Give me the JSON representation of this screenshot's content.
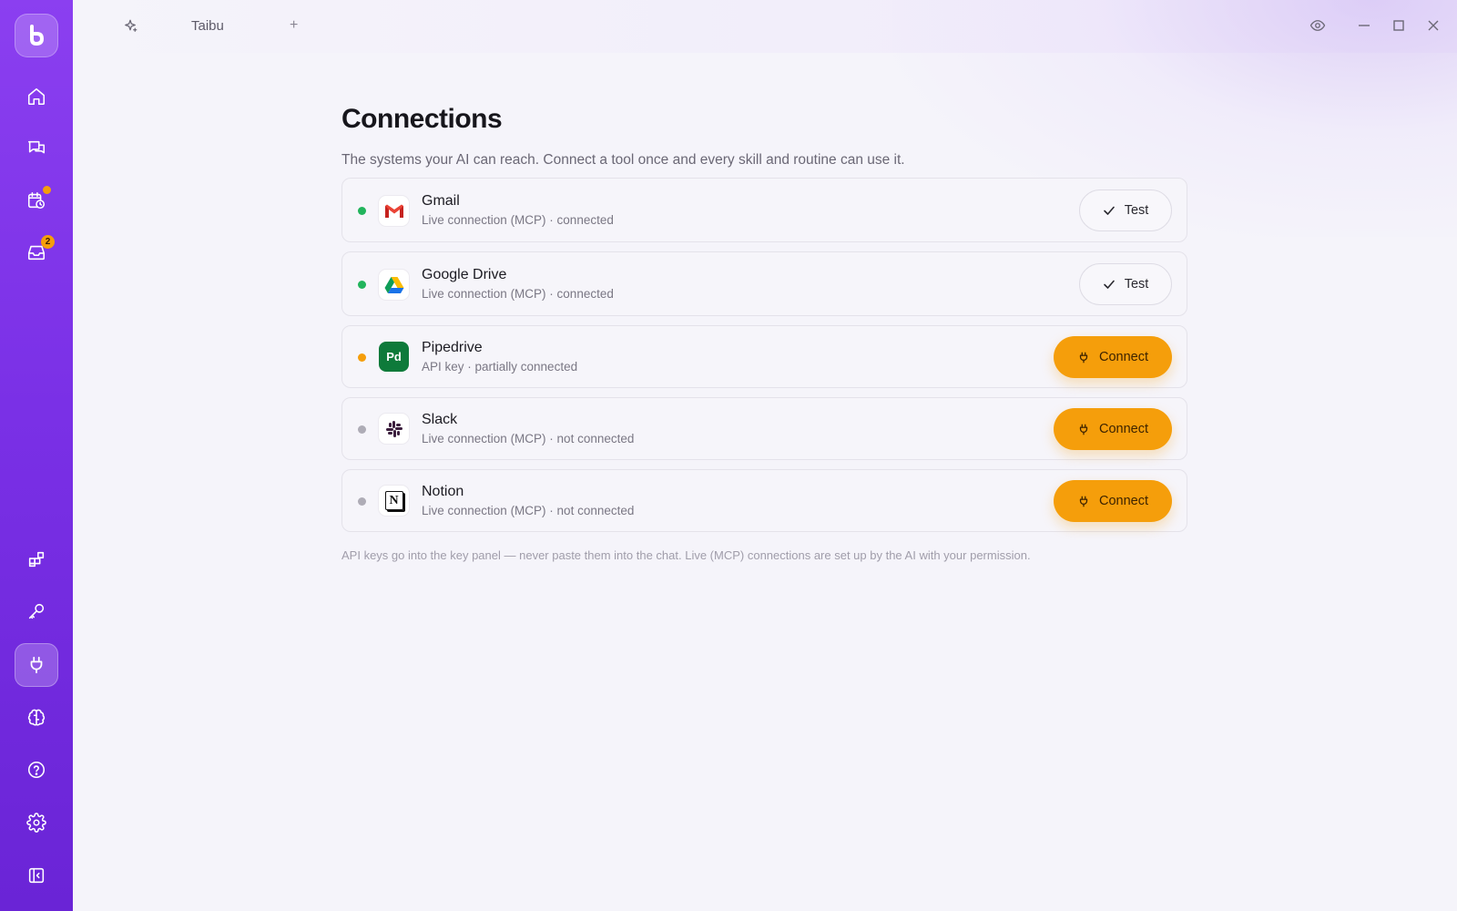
{
  "app": {
    "tab_title": "Taibu",
    "tab_add": "+",
    "accent": "#7a30e6",
    "highlight": "#f59e0b"
  },
  "sidebar": {
    "items": [
      {
        "name": "home",
        "icon": "home-icon"
      },
      {
        "name": "chats",
        "icon": "chat-bubbles-icon"
      },
      {
        "name": "routines",
        "icon": "calendar-clock-icon",
        "badge_dot": true
      },
      {
        "name": "inbox",
        "icon": "inbox-icon",
        "badge_count": "2"
      },
      {
        "name": "skills",
        "icon": "grid-plus-icon"
      },
      {
        "name": "keys",
        "icon": "key-icon"
      },
      {
        "name": "connections",
        "icon": "plug-icon",
        "active": true
      },
      {
        "name": "memory",
        "icon": "brain-icon"
      },
      {
        "name": "help",
        "icon": "help-circle-icon"
      },
      {
        "name": "settings",
        "icon": "gear-icon"
      },
      {
        "name": "collapse",
        "icon": "collapse-sidebar-icon"
      }
    ]
  },
  "page": {
    "title": "Connections",
    "subtitle": "The systems your AI can reach. Connect a tool once and every skill and routine can use it.",
    "footnote": "API keys go into the key panel — never paste them into the chat. Live (MCP) connections are set up by the AI with your permission."
  },
  "connections": [
    {
      "name": "Gmail",
      "desc": "Live connection (MCP) · connected",
      "status_color": "#22b45c",
      "action": "Test",
      "icon": "gmail-icon"
    },
    {
      "name": "Google Drive",
      "desc": "Live connection (MCP) · connected",
      "status_color": "#22b45c",
      "action": "Test",
      "icon": "google-drive-icon"
    },
    {
      "name": "Pipedrive",
      "desc": "API key · partially connected",
      "status_color": "#f59e0b",
      "action": "Connect",
      "icon": "pipedrive-icon",
      "icon_text": "Pd"
    },
    {
      "name": "Slack",
      "desc": "Live connection (MCP) · not connected",
      "status_color": "#aeacb6",
      "action": "Connect",
      "icon": "slack-icon"
    },
    {
      "name": "Notion",
      "desc": "Live connection (MCP) · not connected",
      "status_color": "#aeacb6",
      "action": "Connect",
      "icon": "notion-icon",
      "icon_text": "N"
    }
  ]
}
